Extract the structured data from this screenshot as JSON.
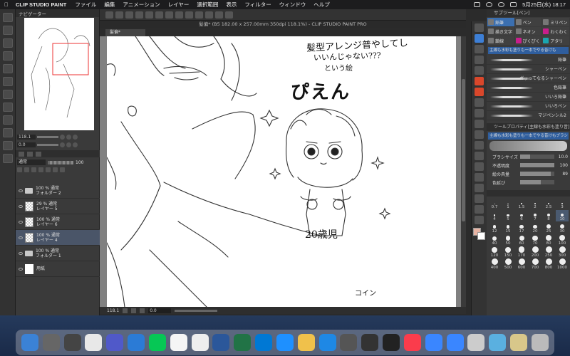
{
  "menubar": {
    "app_name": "CLIP STUDIO PAINT",
    "items": [
      "ファイル",
      "編集",
      "アニメーション",
      "レイヤー",
      "選択範囲",
      "表示",
      "フィルター",
      "ウィンドウ",
      "ヘルプ"
    ],
    "clock": "5月25日(水) 18:17"
  },
  "navigator": {
    "tab_label": "ナビゲーター",
    "zoom": "118.1",
    "rotate": "0.0"
  },
  "layers_panel": {
    "blend_mode": "通常",
    "opacity": "100",
    "layers": [
      {
        "line1": "100 % 通常",
        "line2": "フォルダー 2",
        "kind": "folder",
        "selected": false
      },
      {
        "line1": "29 % 通常",
        "line2": "レイヤー 5",
        "kind": "raster",
        "selected": false
      },
      {
        "line1": "100 % 通常",
        "line2": "レイヤー 6",
        "kind": "raster",
        "selected": false
      },
      {
        "line1": "100 % 通常",
        "line2": "レイヤー 4",
        "kind": "raster",
        "selected": true
      },
      {
        "line1": "100 % 通常",
        "line2": "フォルダー 1",
        "kind": "folder",
        "selected": false
      },
      {
        "line1": "",
        "line2": "用紙",
        "kind": "paper",
        "selected": false
      }
    ]
  },
  "document": {
    "title": "髪偏* (B5 182.00 x 257.00mm 350dpi 118.1%) - CLIP STUDIO PAINT PRO",
    "tab_label": "髪偏*"
  },
  "canvas_text": {
    "note_line1": "髪型アレンジ普やしてし",
    "note_line2": "いいんじゃない???",
    "note_line3": "という絵",
    "pien": "ぴえん",
    "age": "20歳児",
    "coin": "コイン"
  },
  "status_bar": {
    "zoom": "118.1",
    "rotation": "0.0"
  },
  "sub_tool": {
    "header": "サブツール[ペン]",
    "tabs": [
      {
        "label": "鉛筆",
        "active": true,
        "tone": "plain"
      },
      {
        "label": "ペン",
        "active": false,
        "tone": "plain"
      },
      {
        "label": "ミリペン",
        "active": false,
        "tone": "plain"
      },
      {
        "label": "描き文字",
        "active": false,
        "tone": "plain"
      },
      {
        "label": "ネオン",
        "active": false,
        "tone": "plain"
      },
      {
        "label": "わくわく",
        "active": false,
        "tone": "pink"
      },
      {
        "label": "鎖線",
        "active": false,
        "tone": "plain"
      },
      {
        "label": "ぴくぴく",
        "active": false,
        "tone": "pink"
      },
      {
        "label": "アタリ",
        "active": false,
        "tone": "teal"
      }
    ],
    "selected_brush": "主線も水彩も塗りも一本でやる昔けも",
    "brushes": [
      "鉛筆",
      "シャーペン",
      "ガッってなるシャーペン",
      "色鉛筆",
      "いいろ鉛筆",
      "いいろペン",
      "マジペンシル2"
    ]
  },
  "tool_property": {
    "header": "ツールプロパティ[主線も水彩も塗り昔]",
    "brush_name": "主線も水彩も塗りも一本でやる昔けもブラシ",
    "rows": [
      {
        "label": "ブラシサイズ",
        "value": "10.0",
        "fill": 0.3
      },
      {
        "label": "不透明度",
        "value": "100",
        "fill": 1.0
      },
      {
        "label": "絵の具量",
        "value": "89",
        "fill": 0.89
      },
      {
        "label": "色延び",
        "value": "",
        "fill": 0.6
      }
    ]
  },
  "brush_size": {
    "sizes": [
      "0.7",
      "1",
      "1.5",
      "2",
      "2.5",
      "3",
      "4",
      "5",
      "6",
      "7",
      "8",
      "10",
      "12",
      "15",
      "17",
      "20",
      "25",
      "30",
      "40",
      "50",
      "60",
      "70",
      "80",
      "100",
      "120",
      "150",
      "170",
      "200",
      "250",
      "300",
      "400",
      "500",
      "600",
      "700",
      "800",
      "1000"
    ],
    "selected": "10"
  },
  "colors": {
    "main": "#e8b4a4",
    "sub": "#ffffff",
    "accent": "#3b6fb0"
  }
}
